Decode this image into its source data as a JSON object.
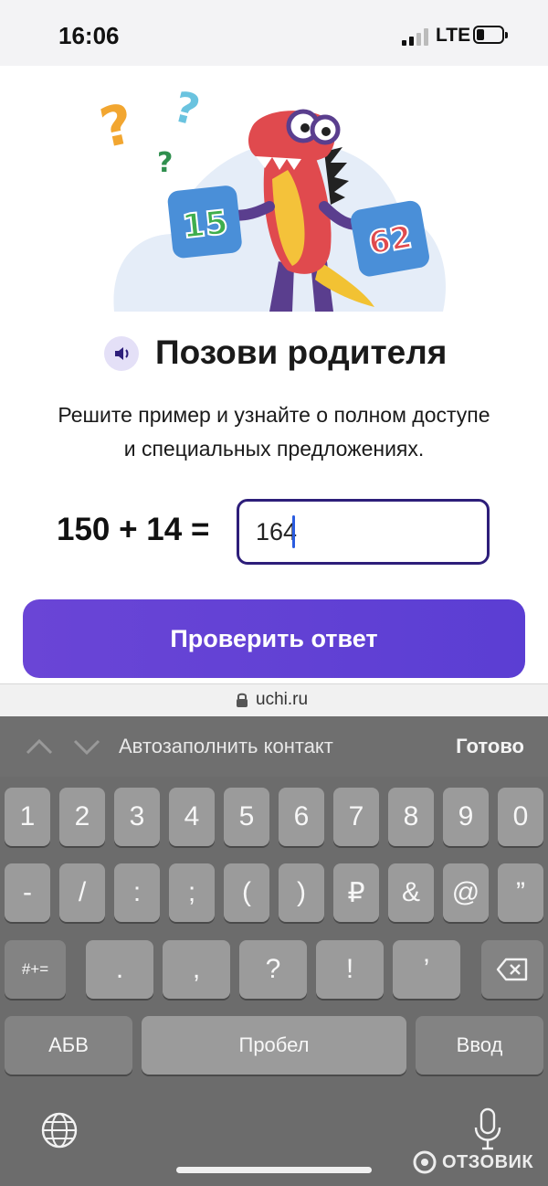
{
  "status": {
    "time": "16:06",
    "network": "LTE"
  },
  "illustration": {
    "card_left": "15",
    "card_right": "62"
  },
  "page": {
    "title": "Позови родителя",
    "subtitle_line1": "Решите пример и узнайте о полном доступе",
    "subtitle_line2": "и специальных предложениях.",
    "equation": "150 + 14 =",
    "answer_value": "164",
    "check_button": "Проверить ответ"
  },
  "browser": {
    "url": "uchi.ru"
  },
  "keyboard": {
    "toolbar": {
      "autofill": "Автозаполнить контакт",
      "done": "Готово"
    },
    "row1": [
      "1",
      "2",
      "3",
      "4",
      "5",
      "6",
      "7",
      "8",
      "9",
      "0"
    ],
    "row2": [
      "-",
      "/",
      ":",
      ";",
      "(",
      ")",
      "₽",
      "&",
      "@",
      "”"
    ],
    "row3": {
      "mode": "#+=",
      "keys": [
        ".",
        ",",
        "?",
        "!",
        "’"
      ]
    },
    "row4": {
      "abc": "АБВ",
      "space": "Пробел",
      "return": "Ввод"
    }
  },
  "watermark": {
    "text": "ОТЗОВИК"
  },
  "colors": {
    "accent": "#5b3ed3",
    "input_border": "#2d1e7a",
    "caret": "#2a5ce0"
  }
}
